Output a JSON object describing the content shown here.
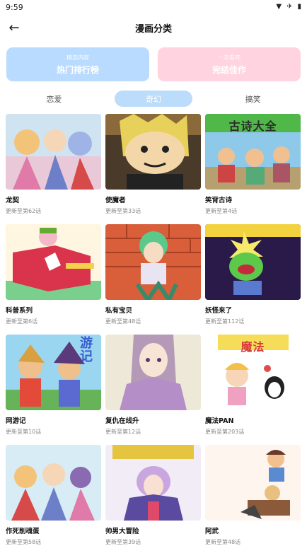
{
  "status": {
    "time": "9:59",
    "wifi_icon": "wifi-icon",
    "airplane_icon": "airplane-icon",
    "battery_icon": "battery-icon"
  },
  "header": {
    "title": "漫画分类",
    "back_icon": "arrow-left-icon"
  },
  "banners": [
    {
      "sub": "精选内容",
      "main": "热门排行榜",
      "color": "#b9dbff"
    },
    {
      "sub": "一次看完",
      "main": "完结佳作",
      "color": "#ffd3e0"
    }
  ],
  "tabs": [
    {
      "label": "恋爱",
      "active": false
    },
    {
      "label": "奇幻",
      "active": true
    },
    {
      "label": "搞笑",
      "active": false
    }
  ],
  "comics": [
    {
      "title": "龙契",
      "progress": "更新至第62话",
      "cover_text": ""
    },
    {
      "title": "使魔者",
      "progress": "更新至第33话",
      "cover_text": ""
    },
    {
      "title": "笑背古诗",
      "progress": "更新至第4话",
      "cover_text": "古诗大全"
    },
    {
      "title": "科普系列",
      "progress": "更新至第6话",
      "cover_text": ""
    },
    {
      "title": "私有宝贝",
      "progress": "更新至第48话",
      "cover_text": ""
    },
    {
      "title": "妖怪来了",
      "progress": "更新至第112话",
      "cover_text": ""
    },
    {
      "title": "网游记",
      "progress": "更新至第10话",
      "cover_text": "游记"
    },
    {
      "title": "复仇在线升",
      "progress": "更新至第12话",
      "cover_text": ""
    },
    {
      "title": "魔法PAN",
      "progress": "更新至第203话",
      "cover_text": "魔法"
    },
    {
      "title": "作死削魂蛋",
      "progress": "更新至第58话",
      "cover_text": ""
    },
    {
      "title": "帅男大冒险",
      "progress": "更新至第39话",
      "cover_text": ""
    },
    {
      "title": "阿武",
      "progress": "更新至第48话",
      "cover_text": ""
    }
  ]
}
